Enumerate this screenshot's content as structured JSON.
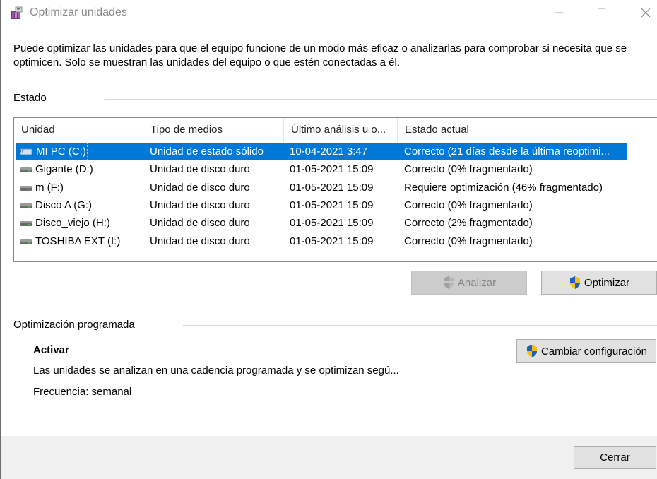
{
  "window": {
    "title": "Optimizar unidades"
  },
  "description": "Puede optimizar las unidades para que el equipo funcione de un modo más eficaz o analizarlas para comprobar si necesita que se optimicen. Solo se muestran las unidades del equipo o que estén conectadas a él.",
  "status_group": {
    "title": "Estado",
    "columns": [
      "Unidad",
      "Tipo de medios",
      "Último análisis u o...",
      "Estado actual"
    ],
    "rows": [
      {
        "unit": "MI PC (C:)",
        "media": "Unidad de estado sólido",
        "last": "10-04-2021 3:47",
        "status": "Correcto (21 días desde la última reoptimi...",
        "icon": "ssd-drive-icon",
        "selected": true
      },
      {
        "unit": "Gigante (D:)",
        "media": "Unidad de disco duro",
        "last": "01-05-2021 15:09",
        "status": "Correcto (0% fragmentado)",
        "icon": "hard-drive-icon",
        "selected": false
      },
      {
        "unit": "m (F:)",
        "media": "Unidad de disco duro",
        "last": "01-05-2021 15:09",
        "status": "Requiere optimización (46% fragmentado)",
        "icon": "hard-drive-icon",
        "selected": false
      },
      {
        "unit": "Disco A (G:)",
        "media": "Unidad de disco duro",
        "last": "01-05-2021 15:09",
        "status": "Correcto (0% fragmentado)",
        "icon": "hard-drive-icon",
        "selected": false
      },
      {
        "unit": "Disco_viejo (H:)",
        "media": "Unidad de disco duro",
        "last": "01-05-2021 15:09",
        "status": "Correcto (2% fragmentado)",
        "icon": "hard-drive-icon",
        "selected": false
      },
      {
        "unit": "TOSHIBA EXT (I:)",
        "media": "Unidad de disco duro",
        "last": "01-05-2021 15:09",
        "status": "Correcto (0% fragmentado)",
        "icon": "hard-drive-icon",
        "selected": false
      }
    ]
  },
  "buttons": {
    "analyze": "Analizar",
    "optimize": "Optimizar",
    "change_settings": "Cambiar configuración",
    "close": "Cerrar"
  },
  "schedule": {
    "title": "Optimización programada",
    "state": "Activar",
    "description": "Las unidades se analizan en una cadencia programada y se optimizan segú...",
    "frequency": "Frecuencia: semanal"
  },
  "colors": {
    "selection": "#0078d7",
    "accent_shield_blue": "#1f5fbf",
    "accent_shield_yellow": "#f4c20d"
  }
}
